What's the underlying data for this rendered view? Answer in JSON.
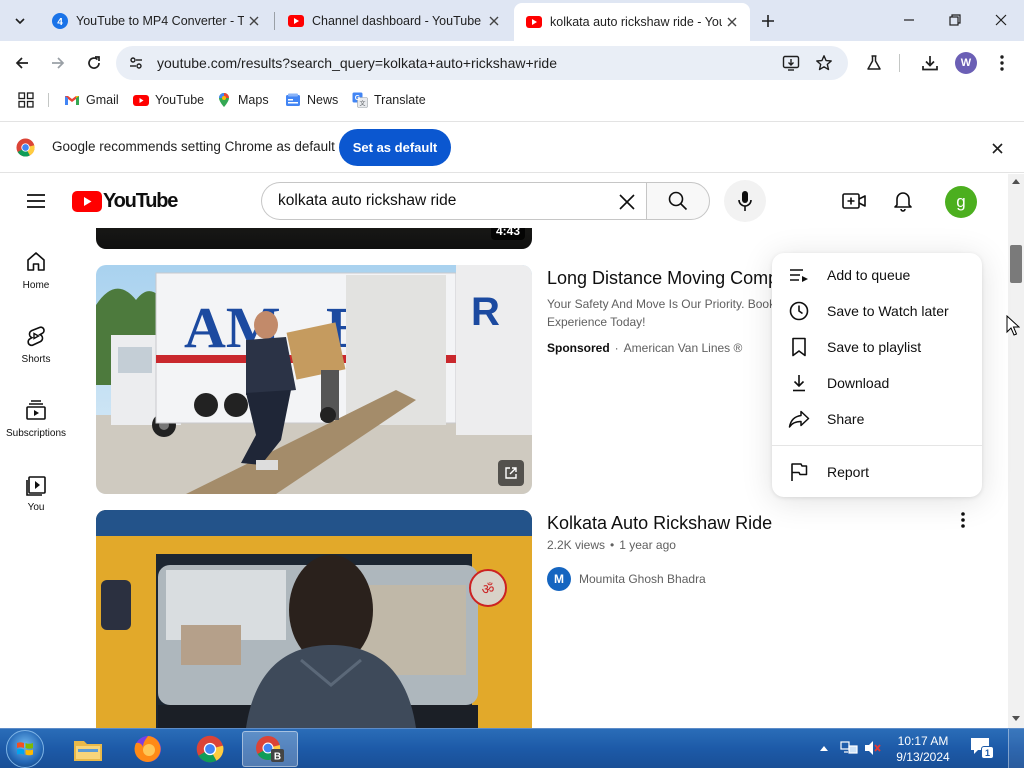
{
  "browser": {
    "tabs": [
      {
        "title": "YouTube to MP4 Converter - Tu",
        "favicon": "converter-icon",
        "active": false
      },
      {
        "title": "Channel dashboard - YouTube",
        "favicon": "youtube-icon",
        "active": false
      },
      {
        "title": "kolkata auto rickshaw ride - You",
        "favicon": "youtube-icon",
        "active": true
      }
    ],
    "url": "youtube.com/results?search_query=kolkata+auto+rickshaw+ride",
    "profile_initial": "W",
    "bookmarks": [
      {
        "label": "Gmail",
        "icon": "gmail-icon"
      },
      {
        "label": "YouTube",
        "icon": "youtube-icon"
      },
      {
        "label": "Maps",
        "icon": "maps-icon"
      },
      {
        "label": "News",
        "icon": "news-icon"
      },
      {
        "label": "Translate",
        "icon": "translate-icon"
      }
    ],
    "infobar": {
      "message": "Google recommends setting Chrome as default",
      "button": "Set as default"
    }
  },
  "youtube": {
    "logo": "YouTube",
    "search_query": "kolkata auto rickshaw ride",
    "avatar_initial": "g",
    "rail": [
      {
        "label": "Home",
        "icon": "home-icon"
      },
      {
        "label": "Shorts",
        "icon": "shorts-icon"
      },
      {
        "label": "Subscriptions",
        "icon": "subscriptions-icon"
      },
      {
        "label": "You",
        "icon": "you-icon"
      }
    ],
    "top_duration": "4:43",
    "ad": {
      "title": "Long Distance Moving Comp",
      "description_line1": "Your Safety And Move Is Our Priority. Book",
      "description_line2": "Experience Today!",
      "badge": "Sponsored",
      "advertiser": "American Van Lines ®"
    },
    "video": {
      "title": "Kolkata Auto Rickshaw Ride",
      "views": "2.2K views",
      "age": "1 year ago",
      "channel": "Moumita Ghosh Bhadra",
      "channel_initial": "M"
    },
    "menu": {
      "items": [
        {
          "label": "Add to queue",
          "icon": "add-to-queue-icon"
        },
        {
          "label": "Save to Watch later",
          "icon": "clock-icon"
        },
        {
          "label": "Save to playlist",
          "icon": "bookmark-icon"
        },
        {
          "label": "Download",
          "icon": "download-icon"
        },
        {
          "label": "Share",
          "icon": "share-icon"
        }
      ],
      "report": {
        "label": "Report",
        "icon": "flag-icon"
      }
    }
  },
  "taskbar": {
    "time": "10:17 AM",
    "date": "9/13/2024",
    "notification_count": "1"
  },
  "colors": {
    "tabstrip": "#dfe6f3",
    "accent_blue": "#0b57d0",
    "youtube_red": "#ff0000",
    "avatar_green": "#4caf1f"
  }
}
